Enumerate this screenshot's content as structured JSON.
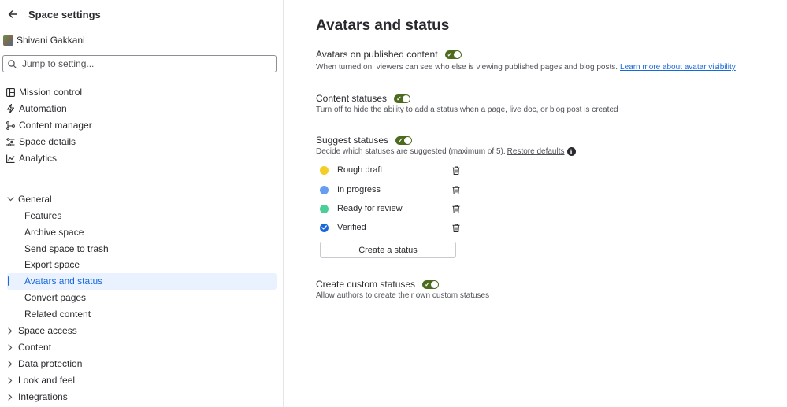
{
  "sidebar": {
    "title": "Space settings",
    "user": {
      "name": "Shivani Gakkani"
    },
    "search": {
      "placeholder": "Jump to setting..."
    },
    "top_items": [
      {
        "label": "Mission control",
        "icon": "mission-control-icon"
      },
      {
        "label": "Automation",
        "icon": "lightning-icon"
      },
      {
        "label": "Content manager",
        "icon": "content-manager-icon"
      },
      {
        "label": "Space details",
        "icon": "sliders-icon"
      },
      {
        "label": "Analytics",
        "icon": "chart-icon"
      }
    ],
    "general": {
      "label": "General",
      "expanded": true,
      "children": [
        {
          "label": "Features"
        },
        {
          "label": "Archive space"
        },
        {
          "label": "Send space to trash"
        },
        {
          "label": "Export space"
        },
        {
          "label": "Avatars and status",
          "selected": true
        },
        {
          "label": "Convert pages"
        },
        {
          "label": "Related content"
        }
      ]
    },
    "collapsed_groups": [
      {
        "label": "Space access"
      },
      {
        "label": "Content"
      },
      {
        "label": "Data protection"
      },
      {
        "label": "Look and feel"
      },
      {
        "label": "Integrations"
      }
    ]
  },
  "main": {
    "title": "Avatars and status",
    "settings": {
      "avatars": {
        "title": "Avatars on published content",
        "enabled": true,
        "description": "When turned on, viewers can see who else is viewing published pages and blog posts.",
        "link": "Learn more about avatar visibility"
      },
      "content_statuses": {
        "title": "Content statuses",
        "enabled": true,
        "description": "Turn off to hide the ability to add a status when a page, live doc, or blog post is created"
      },
      "suggest_statuses": {
        "title": "Suggest statuses",
        "enabled": true,
        "description": "Decide which statuses are suggested (maximum of 5).",
        "restore_link": "Restore defaults"
      },
      "custom_statuses": {
        "title": "Create custom statuses",
        "enabled": true,
        "description": "Allow authors to create their own custom statuses"
      }
    },
    "statuses": [
      {
        "label": "Rough draft",
        "color": "#f5cd27"
      },
      {
        "label": "In progress",
        "color": "#669df1"
      },
      {
        "label": "Ready for review",
        "color": "#4bce97"
      },
      {
        "label": "Verified",
        "color": "#1868db",
        "icon": "verified-check-icon"
      }
    ],
    "create_status_label": "Create a status"
  },
  "colors": {
    "accent": "#1868db",
    "toggle_on": "#4c6b1f",
    "selected_bg": "#e9f2fe"
  }
}
